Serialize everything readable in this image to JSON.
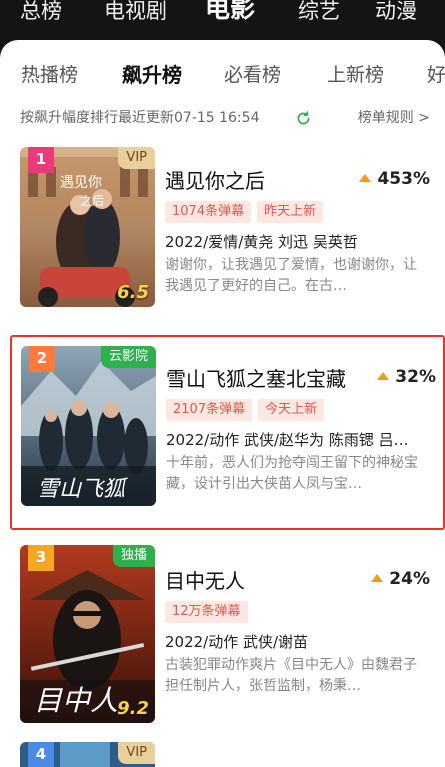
{
  "top_categories": [
    {
      "label": "总榜",
      "active": false
    },
    {
      "label": "电视剧",
      "active": false
    },
    {
      "label": "电影",
      "active": true
    },
    {
      "label": "综艺",
      "active": false
    },
    {
      "label": "动漫",
      "active": false
    }
  ],
  "sub_tabs": [
    {
      "label": "热播榜",
      "active": false
    },
    {
      "label": "飙升榜",
      "active": true
    },
    {
      "label": "必看榜",
      "active": false
    },
    {
      "label": "上新榜",
      "active": false
    },
    {
      "label": "好",
      "active": false
    }
  ],
  "info": {
    "text": "按飙升幅度排行最近更新07-15 16:54",
    "rules_link": "榜单规则 >"
  },
  "colors": {
    "accent_red": "#e8322a",
    "rise_arrow": "#f59a0d",
    "vip_gold": "#e9cf9a",
    "exclusive_green": "#2fb04f",
    "rank1": "#ea3a7a",
    "rank2": "#ff7a3c",
    "rank3": "#f5a623",
    "rank4": "#4b8be6"
  },
  "items": [
    {
      "rank": "1",
      "corner_tag": "VIP",
      "score": "6.5",
      "title": "遇见你之后",
      "rise": "453%",
      "tags": [
        "1074条弹幕",
        "昨天上新"
      ],
      "meta": "2022/爱情/黄尧 刘迅 吴英哲",
      "desc": "谢谢你，让我遇见了爱情，也谢谢你，让我遇见了更好的自己。在古…"
    },
    {
      "rank": "2",
      "corner_tag": "云影院",
      "score": "",
      "title": "雪山飞狐之塞北宝藏",
      "rise": "32%",
      "tags": [
        "2107条弹幕",
        "今天上新"
      ],
      "meta": "2022/动作 武侠/赵华为 陈雨锶 吕…",
      "desc": "十年前，恶人们为抢夺闯王留下的神秘宝藏，设计引出大侠苗人凤与宝…"
    },
    {
      "rank": "3",
      "corner_tag": "独播",
      "score": "9.2",
      "title": "目中无人",
      "rise": "24%",
      "tags": [
        "12万条弹幕"
      ],
      "meta": "2022/动作 武侠/谢苗",
      "desc": "古装犯罪动作爽片《目中无人》由魏君子担任制片人，张哲监制，杨秉…"
    },
    {
      "rank": "4",
      "corner_tag": "VIP",
      "score": "",
      "title": "",
      "rise": "",
      "tags": [],
      "meta": "",
      "desc": ""
    }
  ]
}
